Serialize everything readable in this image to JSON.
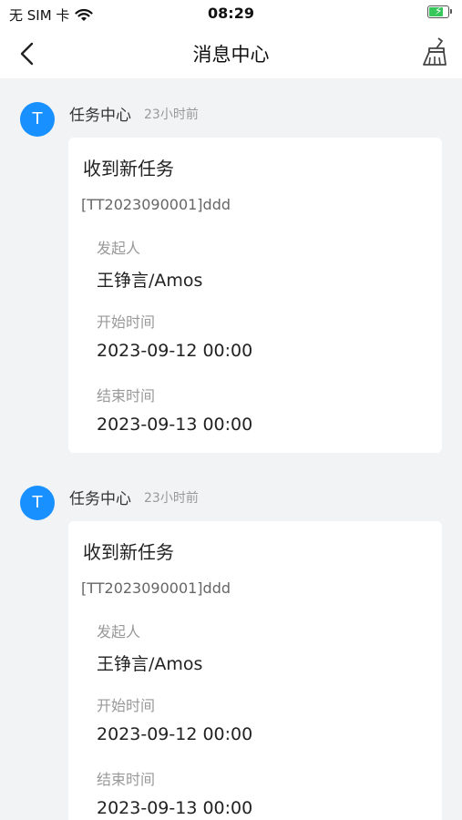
{
  "status_bar": {
    "carrier": "无 SIM 卡",
    "time": "08:29",
    "battery_level": 0.8,
    "battery_color": "#35c759"
  },
  "nav": {
    "title": "消息中心",
    "back_icon": "chevron-left-icon",
    "clear_icon": "broom-icon"
  },
  "messages": [
    {
      "avatar_letter": "T",
      "sender": "任务中心",
      "time_ago": "23小时前",
      "title": "收到新任务",
      "ref": "[TT2023090001]ddd",
      "initiator_label": "发起人",
      "initiator": "王铮言/Amos",
      "start_label": "开始时间",
      "start": "2023-09-12 00:00",
      "end_label": "结束时间",
      "end": "2023-09-13 00:00"
    },
    {
      "avatar_letter": "T",
      "sender": "任务中心",
      "time_ago": "23小时前",
      "title": "收到新任务",
      "ref": "[TT2023090001]ddd",
      "initiator_label": "发起人",
      "initiator": "王铮言/Amos",
      "start_label": "开始时间",
      "start": "2023-09-12 00:00",
      "end_label": "结束时间",
      "end": "2023-09-13 00:00"
    }
  ],
  "colors": {
    "accent": "#1890ff",
    "background": "#f2f3f5",
    "card": "#ffffff"
  }
}
